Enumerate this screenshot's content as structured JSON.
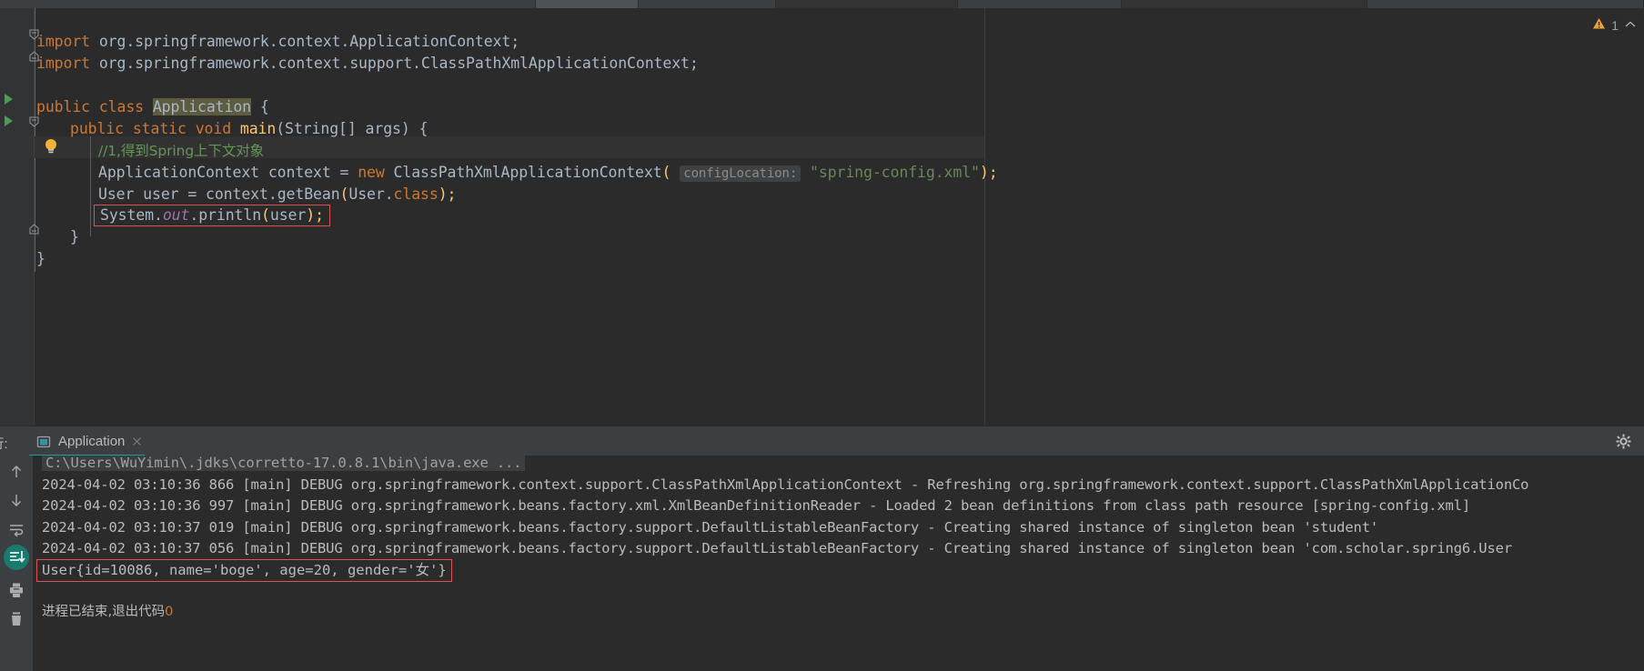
{
  "window": {
    "warning_icon": "warning-triangle-icon",
    "warning_count": "1",
    "collapse_icon": "chevron-up-icon"
  },
  "editor": {
    "lines": [
      {
        "id": "import1",
        "text": "import org.springframework.context.ApplicationContext;"
      },
      {
        "id": "import2",
        "text": "import org.springframework.context.support.ClassPathXmlApplicationContext;"
      },
      {
        "id": "class",
        "kw": "public class",
        "name": "Application",
        "brace": "{"
      },
      {
        "id": "main",
        "text": "public static void main(String[] args) {"
      },
      {
        "id": "comment",
        "text": "//1,得到Spring上下文对象"
      },
      {
        "id": "ctx",
        "text": "ApplicationContext context = new ClassPathXmlApplicationContext(",
        "hint": "configLocation:",
        "arg": "\"spring-config.xml\"",
        "tail": ");"
      },
      {
        "id": "bean",
        "text": "User user = context.getBean(User.class);"
      },
      {
        "id": "println",
        "text": "System.out.println(user);"
      },
      {
        "id": "close1",
        "text": "}"
      },
      {
        "id": "close2",
        "text": "}"
      }
    ],
    "parts": {
      "import_kw": "import",
      "import1_path": " org.springframework.context.ApplicationContext;",
      "import2_path": " org.springframework.context.support.ClassPathXmlApplicationContext;",
      "class_kw": "public class ",
      "class_name": "Application",
      "class_brace": " {",
      "main_kw1": "public static ",
      "main_void": "void ",
      "main_name": "main",
      "main_args": "(String[] args) {",
      "comment_text": "//1,得到Spring上下文对象",
      "ctx_type": "ApplicationContext context = ",
      "ctx_new": "new ",
      "ctx_call": "ClassPathXmlApplicationContext",
      "ctx_paren_open": "(",
      "ctx_hint": "configLocation:",
      "ctx_arg": "\"spring-config.xml\"",
      "ctx_tail": ");",
      "bean_pre": "User user = context.",
      "bean_call": "getBean",
      "bean_open": "(",
      "bean_arg": "User.",
      "bean_class_kw": "class",
      "bean_tail": ");",
      "pr_system": "System.",
      "pr_out": "out",
      "pr_dot": ".",
      "pr_println": "println",
      "pr_open": "(",
      "pr_user": "user",
      "pr_close": ");",
      "brace_close": "}"
    },
    "gutter": {
      "run_class_icon": "run-triangle-icon",
      "run_method_icon": "run-triangle-icon",
      "bulb_icon": "intention-bulb-icon",
      "fold_icon": "code-fold-icon"
    }
  },
  "run_window": {
    "panel_label": "行:",
    "tab_icon": "run-configuration-icon",
    "tab_label": "Application",
    "tab_close_icon": "close-icon",
    "settings_icon": "gear-icon",
    "toolbar": [
      {
        "name": "scroll-up-icon",
        "glyph": "↑"
      },
      {
        "name": "scroll-down-icon",
        "glyph": "↓"
      },
      {
        "name": "soft-wrap-icon",
        "glyph": "wrap"
      },
      {
        "name": "scroll-to-end-icon",
        "glyph": "end"
      },
      {
        "name": "print-icon",
        "glyph": "print"
      },
      {
        "name": "clear-all-icon",
        "glyph": "trash"
      }
    ]
  },
  "console": {
    "command": "C:\\Users\\WuYimin\\.jdks\\corretto-17.0.8.1\\bin\\java.exe ...",
    "log_lines": [
      "2024-04-02 03:10:36 866 [main] DEBUG org.springframework.context.support.ClassPathXmlApplicationContext - Refreshing org.springframework.context.support.ClassPathXmlApplicationCo",
      "2024-04-02 03:10:36 997 [main] DEBUG org.springframework.beans.factory.xml.XmlBeanDefinitionReader - Loaded 2 bean definitions from class path resource [spring-config.xml]",
      "2024-04-02 03:10:37 019 [main] DEBUG org.springframework.beans.factory.support.DefaultListableBeanFactory - Creating shared instance of singleton bean 'student'",
      "2024-04-02 03:10:37 056 [main] DEBUG org.springframework.beans.factory.support.DefaultListableBeanFactory - Creating shared instance of singleton bean 'com.scholar.spring6.User"
    ],
    "result_line": "User{id=10086, name='boge', age=20, gender='女'}",
    "exit_prefix": "进程已结束,退出代码",
    "exit_code": "0"
  },
  "colors": {
    "editor_bg": "#2b2b2b",
    "panel_bg": "#3c3f41",
    "keyword": "#cc7832",
    "string": "#6a8759",
    "comment": "#629755",
    "text": "#a9b7c6",
    "method": "#ffc66d",
    "static_field": "#9876aa",
    "highlight_box": "#e05252",
    "accent_teal": "#1a9e8f",
    "warning_yellow": "#e8a33d",
    "run_green": "#499c54"
  }
}
